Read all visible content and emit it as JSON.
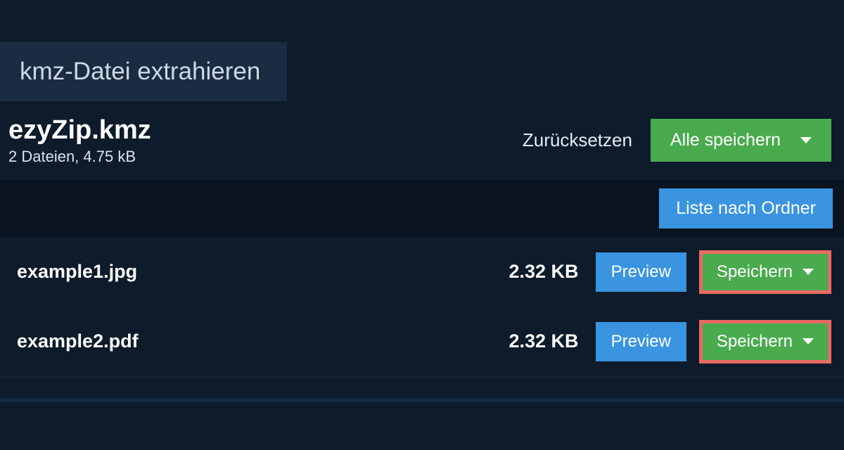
{
  "tab": {
    "label": "kmz-Datei extrahieren"
  },
  "file": {
    "name": "ezyZip.kmz",
    "meta": "2 Dateien, 4.75 kB"
  },
  "actions": {
    "reset": "Zurücksetzen",
    "save_all": "Alle speichern",
    "folder_view": "Liste nach Ordner",
    "preview": "Preview",
    "save": "Speichern"
  },
  "rows": [
    {
      "name": "example1.jpg",
      "size": "2.32 KB"
    },
    {
      "name": "example2.pdf",
      "size": "2.32 KB"
    }
  ]
}
